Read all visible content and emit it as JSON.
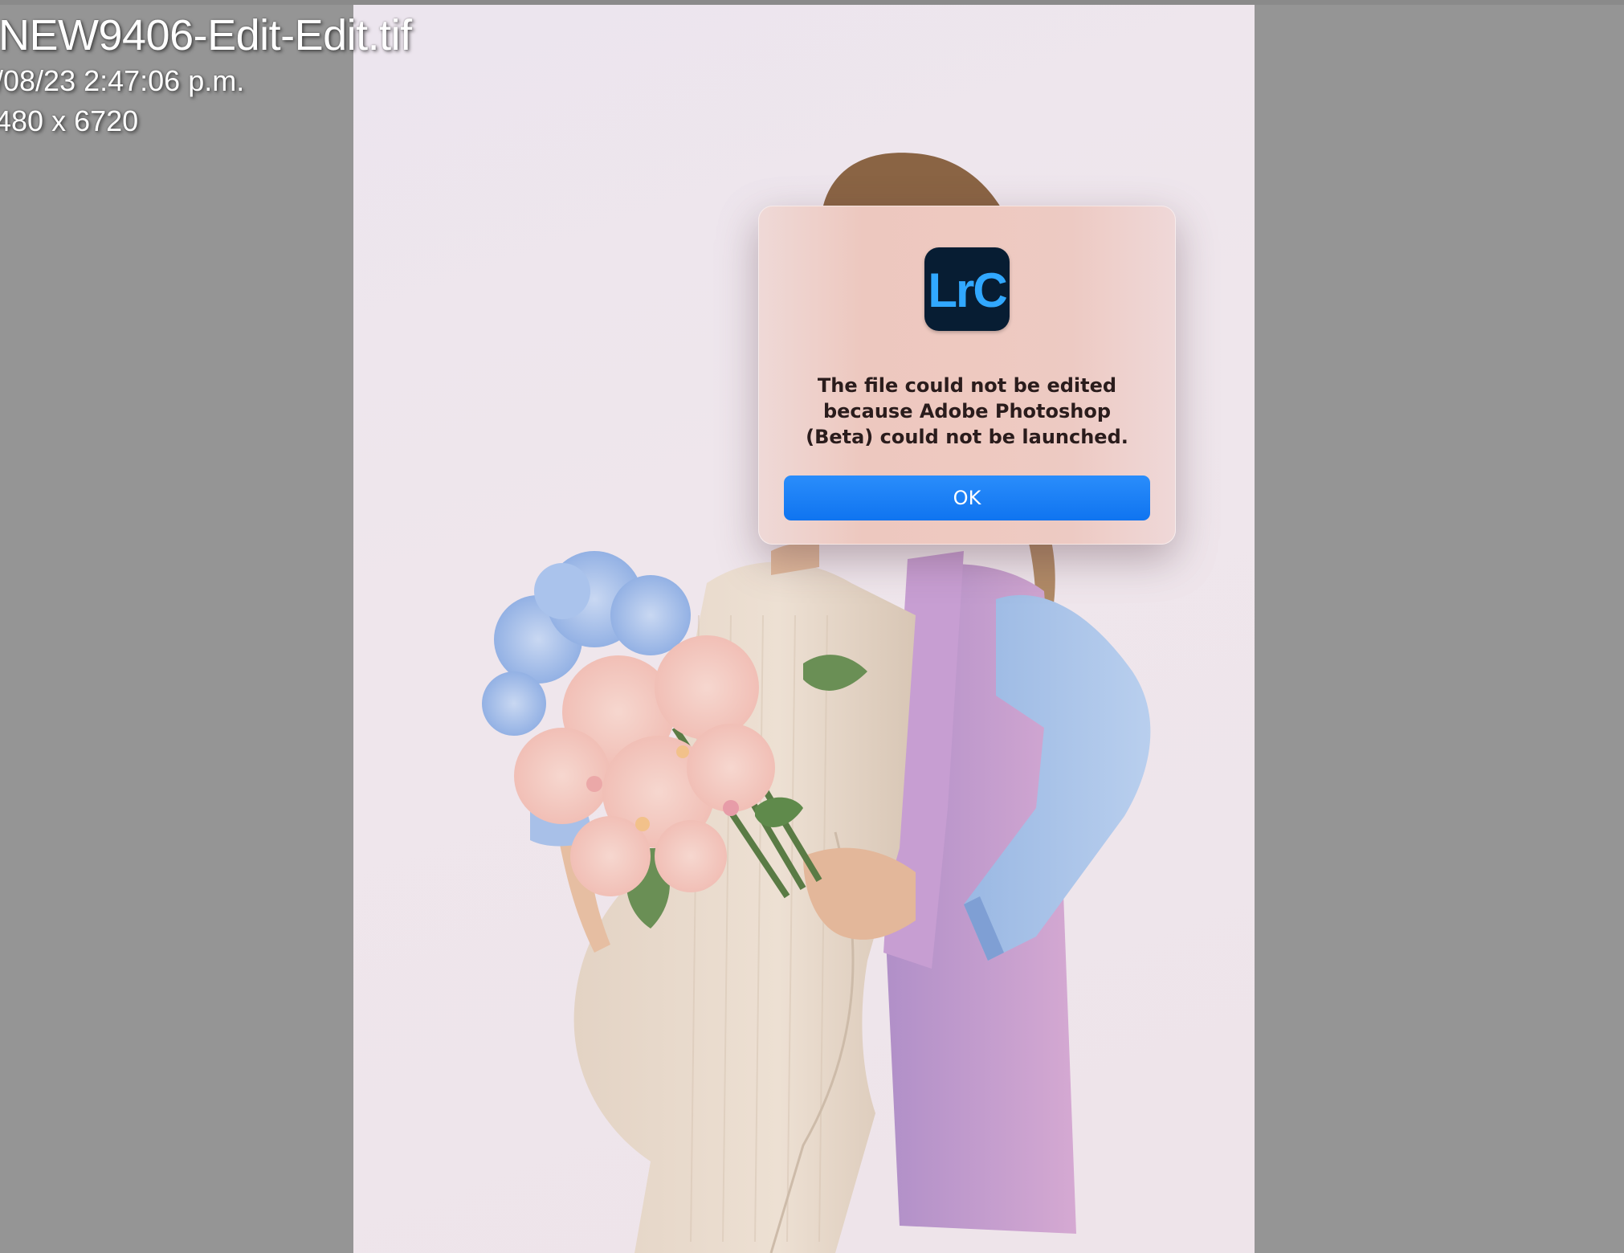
{
  "info_overlay": {
    "filename": "NEW9406-Edit-Edit.tif",
    "date": "/08/23 2:47:06 p.m.",
    "dimensions": "480 x 6720"
  },
  "dialog": {
    "app_icon_text": "LrC",
    "message_line1": "The file could not be edited",
    "message_line2": "because Adobe Photoshop",
    "message_line3": "(Beta) could not be launched.",
    "ok_label": "OK"
  },
  "colors": {
    "workspace_gray": "#959595",
    "accent_blue": "#0f74f0",
    "app_icon_bg": "#071d33",
    "app_icon_text": "#31a8ff"
  }
}
